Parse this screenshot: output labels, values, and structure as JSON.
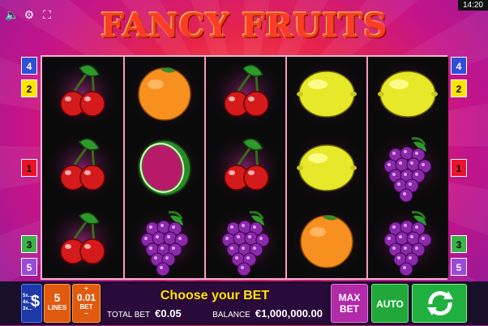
{
  "status": {
    "time": "14:20"
  },
  "title": "FANCY FRUITS",
  "left_markers": [
    "4",
    "2",
    "1",
    "3",
    "5"
  ],
  "right_markers": [
    "4",
    "2",
    "1",
    "3",
    "5"
  ],
  "reels": [
    [
      "cherries",
      "cherries",
      "cherries"
    ],
    [
      "orange",
      "watermelon",
      "grapes"
    ],
    [
      "cherries",
      "cherries",
      "grapes"
    ],
    [
      "lemon",
      "lemon",
      "orange"
    ],
    [
      "lemon",
      "grapes",
      "grapes"
    ]
  ],
  "bottom": {
    "stake_icon": {
      "lines": [
        "5x...",
        "4x...",
        "3x..."
      ],
      "symbol": "$"
    },
    "lines": {
      "value": "5",
      "label": "LINES"
    },
    "bet": {
      "plus": "+",
      "minus": "−",
      "value": "0.01",
      "label": "BET"
    },
    "message": "Choose your BET",
    "total_bet_label": "TOTAL BET",
    "total_bet_value": "€0.05",
    "balance_label": "BALANCE",
    "balance_value": "€1,000,000.00",
    "max_bet": {
      "line1": "MAX",
      "line2": "BET"
    },
    "auto": "AUTO"
  },
  "colors": {
    "marker_blue": "#2f4fd8",
    "marker_yellow": "#ffe400",
    "marker_red": "#e8142a",
    "marker_green": "#3ab44a",
    "marker_purple": "#9a4ad8",
    "max_bet": "#b12aa8",
    "auto": "#22a83a",
    "spin": "#20b040"
  }
}
